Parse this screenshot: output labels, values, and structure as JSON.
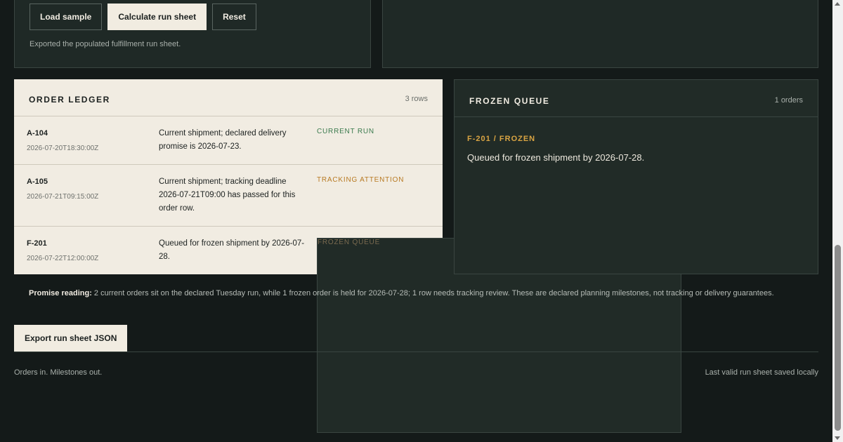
{
  "controls": {
    "load_label": "Load sample",
    "calculate_label": "Calculate run sheet",
    "reset_label": "Reset",
    "status": "Exported the populated fulfillment run sheet."
  },
  "ledger": {
    "title": "ORDER LEDGER",
    "count": "3 rows",
    "rows": [
      {
        "id": "A-104",
        "timestamp": "2026-07-20T18:30:00Z",
        "description": "Current shipment; declared delivery promise is 2026-07-23.",
        "tag": "CURRENT RUN"
      },
      {
        "id": "A-105",
        "timestamp": "2026-07-21T09:15:00Z",
        "description": "Current shipment; tracking deadline 2026-07-21T09:00 has passed for this order row.",
        "tag": "TRACKING ATTENTION"
      },
      {
        "id": "F-201",
        "timestamp": "2026-07-22T12:00:00Z",
        "description": "Queued for frozen shipment by 2026-07-28.",
        "tag": "FROZEN QUEUE"
      }
    ]
  },
  "frozen": {
    "title": "FROZEN QUEUE",
    "count": "1 orders",
    "item_id": "F-201 / FROZEN",
    "item_text": "Queued for frozen shipment by 2026-07-28."
  },
  "promise": {
    "label": "Promise reading:",
    "text": "2 current orders sit on the declared Tuesday run, while 1 frozen order is held for 2026-07-28; 1 row needs tracking review. These are declared planning milestones, not tracking or delivery guarantees."
  },
  "export_label": "Export run sheet JSON",
  "footer": {
    "left": "Orders in. Milestones out.",
    "right": "Last valid run sheet saved locally"
  },
  "colors": {
    "background": "#141a19",
    "ledger_bg": "#f1ece2",
    "current": "#3a7a4d",
    "tracking": "#b87a23",
    "frozen_accent": "#d9a443"
  }
}
